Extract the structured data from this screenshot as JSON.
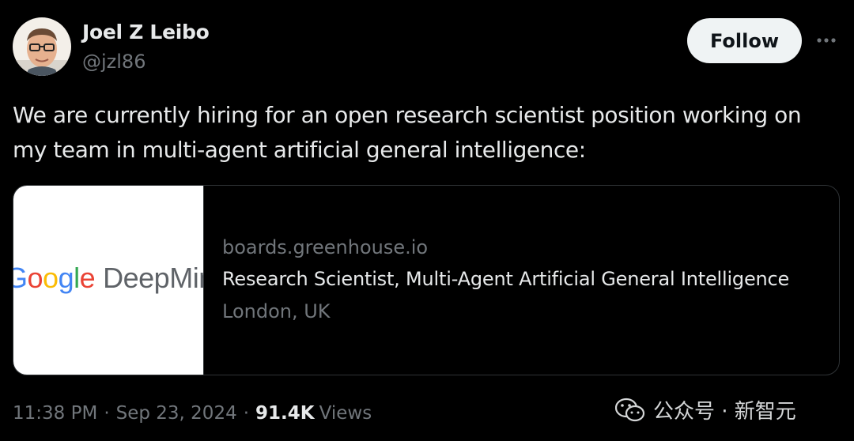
{
  "author": {
    "name": "Joel Z Leibo",
    "handle": "@jzl86",
    "avatar_icon": "person-avatar"
  },
  "actions": {
    "follow_label": "Follow",
    "more_icon": "more-horizontal-icon"
  },
  "tweet": {
    "text": "We are currently hiring for an open research scientist position working on\nmy team in multi-agent artificial general intelligence:"
  },
  "link_card": {
    "image_logo": {
      "google_letters": [
        "G",
        "o",
        "o",
        "g",
        "l",
        "e"
      ],
      "product": "DeepMind"
    },
    "domain": "boards.greenhouse.io",
    "title": "Research Scientist, Multi-Agent Artificial General Intelligence",
    "location": "London, UK"
  },
  "meta": {
    "time": "11:38 PM",
    "separator": "·",
    "date": "Sep 23, 2024",
    "views_count": "91.4K",
    "views_label": "Views"
  },
  "watermark": {
    "icon": "wechat-icon",
    "text": "公众号 · 新智元"
  },
  "colors": {
    "background": "#000000",
    "primary_text": "#e7e9ea",
    "secondary_text": "#71767b",
    "border": "#2f3336",
    "follow_bg": "#eff3f4"
  }
}
